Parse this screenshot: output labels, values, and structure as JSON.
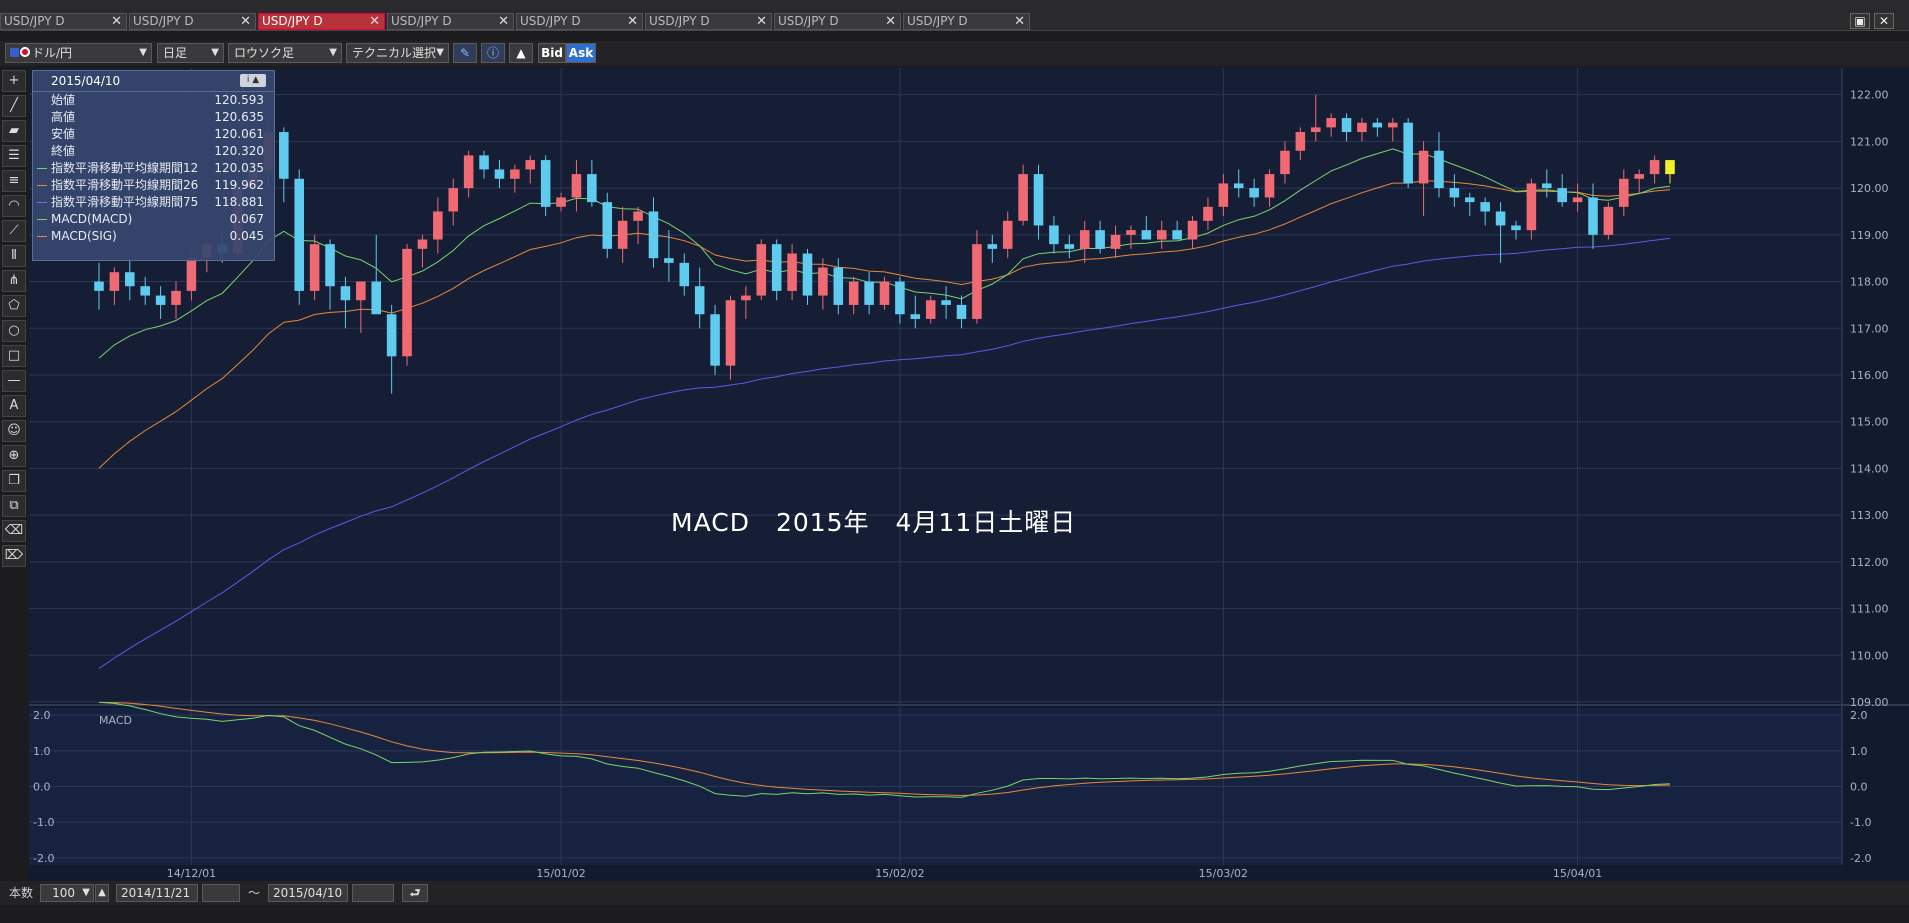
{
  "tabs": [
    {
      "label": "USD/JPY D",
      "active": false
    },
    {
      "label": "USD/JPY D",
      "active": false
    },
    {
      "label": "USD/JPY D",
      "active": true
    },
    {
      "label": "USD/JPY D",
      "active": false
    },
    {
      "label": "USD/JPY D",
      "active": false
    },
    {
      "label": "USD/JPY D",
      "active": false
    },
    {
      "label": "USD/JPY D",
      "active": false
    },
    {
      "label": "USD/JPY D",
      "active": false
    }
  ],
  "toolbar": {
    "symbol": "ドル/円",
    "period": "日足",
    "chart_type": "ロウソク足",
    "technical": "テクニカル選択",
    "bid": "Bid",
    "ask": "Ask"
  },
  "info": {
    "date": "2015/04/10",
    "rows": [
      {
        "label": "始値",
        "value": "120.593",
        "color": ""
      },
      {
        "label": "高値",
        "value": "120.635",
        "color": ""
      },
      {
        "label": "安値",
        "value": "120.061",
        "color": ""
      },
      {
        "label": "終値",
        "value": "120.320",
        "color": ""
      },
      {
        "label": "指数平滑移動平均線期間12",
        "value": "120.035",
        "color": "#7bd36c"
      },
      {
        "label": "指数平滑移動平均線期間26",
        "value": "119.962",
        "color": "#e6893a"
      },
      {
        "label": "指数平滑移動平均線期間75",
        "value": "118.881",
        "color": "#6f6ff0"
      },
      {
        "label": "MACD(MACD)",
        "value": "0.067",
        "color": "#7bd36c"
      },
      {
        "label": "MACD(SIG)",
        "value": "0.045",
        "color": "#e6893a"
      }
    ]
  },
  "watermark": "MACD　2015年　4月11日土曜日",
  "macd_label": "MACD",
  "bottom": {
    "count_label": "本数",
    "count_value": "100",
    "from_date": "2014/11/21",
    "tilde": "～",
    "to_date": "2015/04/10"
  },
  "chart_data": {
    "type": "candlestick",
    "ylim": [
      109,
      122.4
    ],
    "y_ticks": [
      "122.00",
      "121.00",
      "120.00",
      "119.00",
      "118.00",
      "117.00",
      "116.00",
      "115.00",
      "114.00",
      "113.00",
      "112.00",
      "111.00",
      "110.00",
      "109.00"
    ],
    "macd_ylim": [
      -2.2,
      2.2
    ],
    "macd_ticks": [
      "2.0",
      "1.0",
      "0.0",
      "-1.0",
      "-2.0"
    ],
    "x_tick_labels": [
      "14/12/01",
      "15/01/02",
      "15/02/02",
      "15/03/02",
      "15/04/01"
    ],
    "x_tick_index": [
      6,
      30,
      52,
      73,
      96
    ],
    "candles": [
      [
        118.0,
        118.4,
        117.4,
        117.8
      ],
      [
        117.8,
        118.3,
        117.5,
        118.2
      ],
      [
        118.2,
        118.5,
        117.6,
        117.9
      ],
      [
        117.9,
        118.1,
        117.5,
        117.7
      ],
      [
        117.7,
        117.9,
        117.2,
        117.5
      ],
      [
        117.5,
        118.0,
        117.2,
        117.8
      ],
      [
        117.8,
        118.6,
        117.6,
        118.5
      ],
      [
        118.5,
        118.9,
        118.2,
        118.8
      ],
      [
        118.8,
        119.1,
        118.4,
        118.6
      ],
      [
        118.6,
        120.2,
        118.5,
        120.0
      ],
      [
        120.0,
        120.6,
        119.8,
        120.4
      ],
      [
        120.4,
        121.4,
        120.0,
        121.2
      ],
      [
        121.2,
        121.3,
        119.7,
        120.2
      ],
      [
        120.2,
        120.4,
        117.5,
        117.8
      ],
      [
        117.8,
        119.0,
        117.6,
        118.8
      ],
      [
        118.8,
        118.9,
        117.4,
        117.9
      ],
      [
        117.9,
        118.1,
        117.0,
        117.6
      ],
      [
        117.6,
        118.0,
        116.9,
        118.0
      ],
      [
        118.0,
        119.0,
        117.8,
        117.3
      ],
      [
        117.3,
        117.5,
        115.6,
        116.4
      ],
      [
        116.4,
        118.8,
        116.2,
        118.7
      ],
      [
        118.7,
        119.0,
        118.3,
        118.9
      ],
      [
        118.9,
        119.8,
        118.6,
        119.5
      ],
      [
        119.5,
        120.2,
        119.2,
        120.0
      ],
      [
        120.0,
        120.8,
        119.8,
        120.7
      ],
      [
        120.7,
        120.8,
        120.2,
        120.4
      ],
      [
        120.4,
        120.6,
        120.0,
        120.2
      ],
      [
        120.2,
        120.5,
        119.9,
        120.4
      ],
      [
        120.4,
        120.7,
        120.1,
        120.6
      ],
      [
        120.6,
        120.7,
        119.4,
        119.6
      ],
      [
        119.6,
        119.9,
        119.5,
        119.8
      ],
      [
        119.8,
        120.6,
        119.5,
        120.3
      ],
      [
        120.3,
        120.6,
        119.6,
        119.7
      ],
      [
        119.7,
        119.9,
        118.5,
        118.7
      ],
      [
        118.7,
        119.6,
        118.4,
        119.3
      ],
      [
        119.3,
        119.6,
        118.8,
        119.5
      ],
      [
        119.5,
        119.8,
        118.3,
        118.5
      ],
      [
        118.5,
        119.1,
        118.0,
        118.4
      ],
      [
        118.4,
        118.6,
        117.7,
        117.9
      ],
      [
        117.9,
        118.3,
        117.0,
        117.3
      ],
      [
        117.3,
        117.5,
        116.0,
        116.2
      ],
      [
        116.2,
        117.7,
        115.9,
        117.6
      ],
      [
        117.6,
        117.9,
        117.2,
        117.7
      ],
      [
        117.7,
        118.9,
        117.6,
        118.8
      ],
      [
        118.8,
        118.9,
        117.6,
        117.8
      ],
      [
        117.8,
        118.8,
        117.6,
        118.6
      ],
      [
        118.6,
        118.7,
        117.5,
        117.7
      ],
      [
        117.7,
        118.5,
        117.4,
        118.3
      ],
      [
        118.3,
        118.5,
        117.3,
        117.5
      ],
      [
        117.5,
        118.1,
        117.3,
        118.0
      ],
      [
        118.0,
        118.2,
        117.3,
        117.5
      ],
      [
        117.5,
        118.1,
        117.4,
        118.0
      ],
      [
        118.0,
        118.1,
        117.1,
        117.3
      ],
      [
        117.3,
        117.7,
        117.0,
        117.2
      ],
      [
        117.2,
        117.7,
        117.1,
        117.6
      ],
      [
        117.6,
        117.9,
        117.2,
        117.5
      ],
      [
        117.5,
        117.7,
        117.0,
        117.2
      ],
      [
        117.2,
        119.1,
        117.1,
        118.8
      ],
      [
        118.8,
        119.0,
        118.4,
        118.7
      ],
      [
        118.7,
        119.5,
        118.5,
        119.3
      ],
      [
        119.3,
        120.5,
        119.2,
        120.3
      ],
      [
        120.3,
        120.5,
        118.9,
        119.2
      ],
      [
        119.2,
        119.4,
        118.6,
        118.8
      ],
      [
        118.8,
        119.0,
        118.5,
        118.7
      ],
      [
        118.7,
        119.3,
        118.4,
        119.1
      ],
      [
        119.1,
        119.3,
        118.6,
        118.7
      ],
      [
        118.7,
        119.2,
        118.5,
        119.0
      ],
      [
        119.0,
        119.2,
        118.7,
        119.1
      ],
      [
        119.1,
        119.4,
        118.9,
        118.9
      ],
      [
        118.9,
        119.3,
        118.7,
        119.1
      ],
      [
        119.1,
        119.3,
        118.9,
        118.9
      ],
      [
        118.9,
        119.4,
        118.7,
        119.3
      ],
      [
        119.3,
        119.8,
        119.1,
        119.6
      ],
      [
        119.6,
        120.3,
        119.4,
        120.1
      ],
      [
        120.1,
        120.4,
        119.8,
        120.0
      ],
      [
        120.0,
        120.2,
        119.6,
        119.8
      ],
      [
        119.8,
        120.4,
        119.6,
        120.3
      ],
      [
        120.3,
        121.0,
        120.1,
        120.8
      ],
      [
        120.8,
        121.3,
        120.6,
        121.2
      ],
      [
        121.2,
        122.0,
        121.0,
        121.3
      ],
      [
        121.3,
        121.6,
        121.1,
        121.5
      ],
      [
        121.5,
        121.6,
        121.0,
        121.2
      ],
      [
        121.2,
        121.5,
        121.0,
        121.4
      ],
      [
        121.4,
        121.5,
        121.1,
        121.3
      ],
      [
        121.3,
        121.5,
        121.0,
        121.4
      ],
      [
        121.4,
        121.5,
        120.0,
        120.1
      ],
      [
        120.1,
        121.0,
        119.4,
        120.8
      ],
      [
        120.8,
        121.2,
        119.8,
        120.0
      ],
      [
        120.0,
        120.3,
        119.6,
        119.8
      ],
      [
        119.8,
        119.9,
        119.4,
        119.7
      ],
      [
        119.7,
        119.8,
        119.2,
        119.5
      ],
      [
        119.5,
        119.7,
        118.4,
        119.2
      ],
      [
        119.2,
        119.3,
        118.9,
        119.1
      ],
      [
        119.1,
        120.2,
        118.9,
        120.1
      ],
      [
        120.1,
        120.4,
        119.8,
        120.0
      ],
      [
        120.0,
        120.3,
        119.6,
        119.7
      ],
      [
        119.7,
        120.1,
        119.5,
        119.8
      ],
      [
        119.8,
        120.1,
        118.7,
        119.0
      ],
      [
        119.0,
        119.7,
        118.9,
        119.6
      ],
      [
        119.6,
        120.4,
        119.4,
        120.2
      ],
      [
        120.2,
        120.4,
        119.9,
        120.3
      ],
      [
        120.3,
        120.7,
        120.1,
        120.6
      ],
      [
        120.6,
        120.6,
        120.1,
        120.3
      ]
    ],
    "ema12_start": 116.1,
    "ema26_start": 113.7,
    "ema75_start": 109.5
  }
}
